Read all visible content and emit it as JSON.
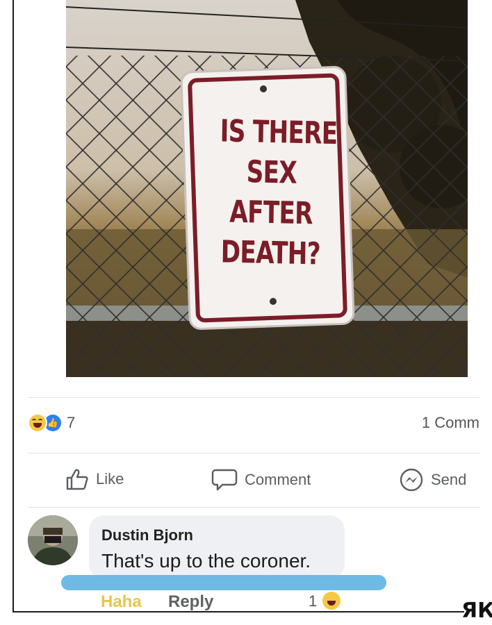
{
  "post": {
    "sign_lines": [
      "IS THERE",
      "SEX",
      "AFTER",
      "DEATH?"
    ]
  },
  "stats": {
    "reaction_count": "7",
    "comments": "1 Comm"
  },
  "actions": {
    "like": "Like",
    "comment": "Comment",
    "send": "Send"
  },
  "comment": {
    "author": "Dustin Bjorn",
    "text": "That's up to the coroner.",
    "haha": "Haha",
    "reply": "Reply",
    "reaction_count": "1"
  },
  "watermark": "ЯК",
  "colors": {
    "sign_red": "#7b1d27",
    "like_blue": "#2d7ff5",
    "haha_yellow": "#f6c944",
    "highlight_blue": "#56aee0"
  },
  "icons": [
    "like-icon",
    "comment-icon",
    "messenger-icon",
    "haha-emoji-icon",
    "like-emoji-icon"
  ]
}
